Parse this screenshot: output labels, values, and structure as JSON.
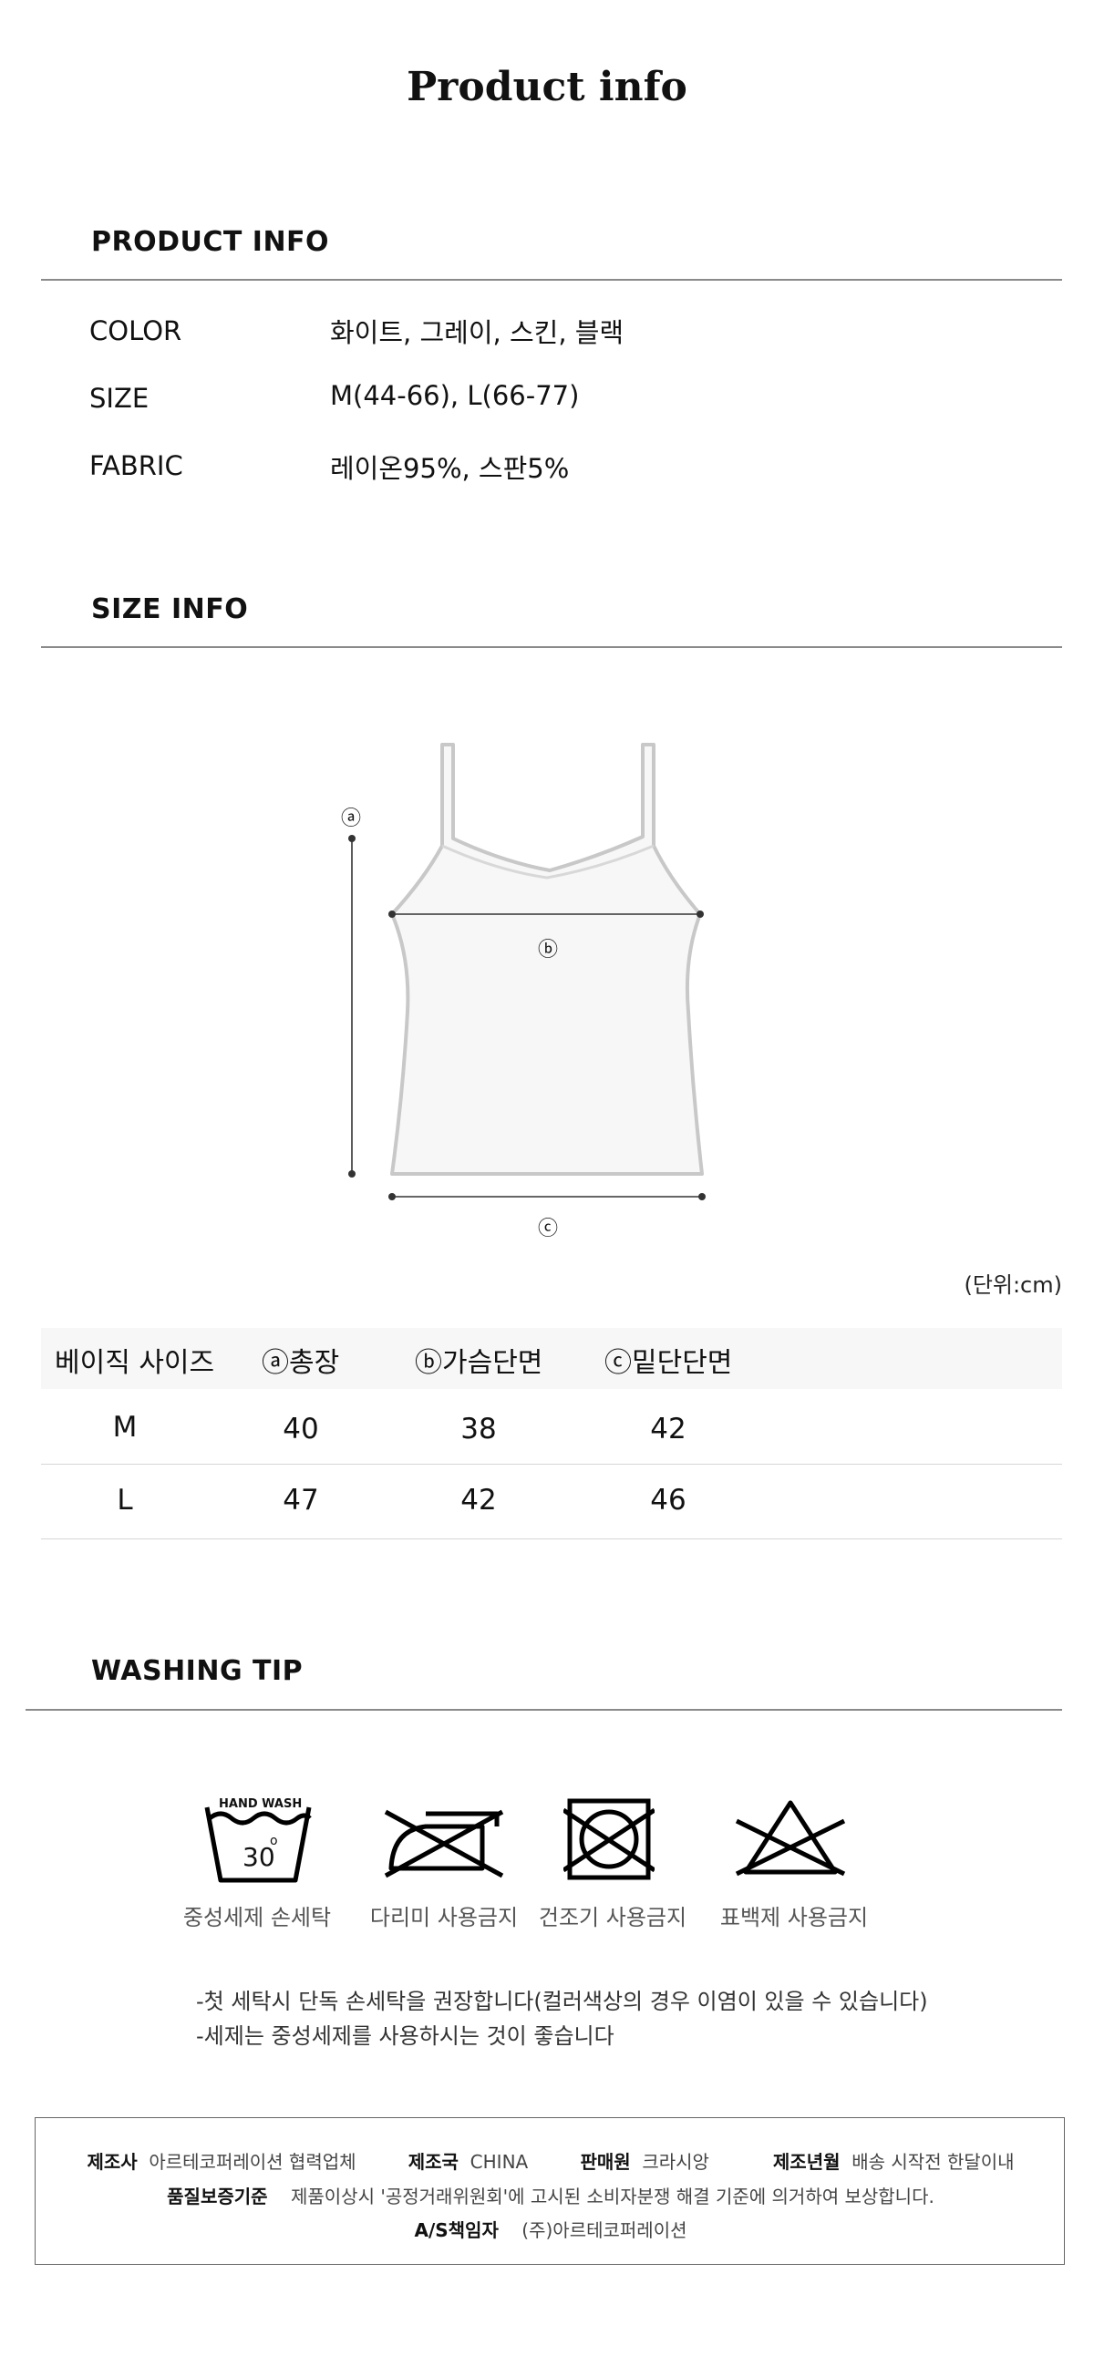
{
  "page_title": "Product info",
  "product_info": {
    "heading": "PRODUCT INFO",
    "rows": [
      {
        "label": "COLOR",
        "value": "화이트, 그레이, 스킨, 블랙"
      },
      {
        "label": "SIZE",
        "value": "M(44-66), L(66-77)"
      },
      {
        "label": "FABRIC",
        "value": "레이온95%, 스판5%"
      }
    ]
  },
  "size_info": {
    "heading": "SIZE INFO",
    "markers": {
      "a": "ⓐ",
      "b": "ⓑ",
      "c": "ⓒ"
    },
    "unit": "(단위:cm)",
    "table": {
      "headers": [
        "베이직 사이즈",
        "ⓐ총장",
        "ⓑ가슴단면",
        "ⓒ밑단단면"
      ],
      "rows": [
        [
          "M",
          "40",
          "38",
          "42"
        ],
        [
          "L",
          "47",
          "42",
          "46"
        ]
      ]
    }
  },
  "washing_tip": {
    "heading": "WASHING TIP",
    "icons": [
      {
        "icon": "hand-wash-icon",
        "caption": "중성세제 손세탁",
        "tub_label": "HAND WASH",
        "temp": "30"
      },
      {
        "icon": "no-iron-icon",
        "caption": "다리미 사용금지"
      },
      {
        "icon": "no-tumble-dry-icon",
        "caption": "건조기 사용금지"
      },
      {
        "icon": "no-bleach-icon",
        "caption": "표백제 사용금지"
      }
    ],
    "notes": [
      "-첫 세탁시 단독 손세탁을 권장합니다(컬러색상의 경우 이염이 있을 수 있습니다)",
      "-세제는 중성세제를 사용하시는 것이 좋습니다"
    ]
  },
  "footer": {
    "manufacturer_label": "제조사",
    "manufacturer": "아르테코퍼레이션 협력업체",
    "country_label": "제조국",
    "country": "CHINA",
    "seller_label": "판매원",
    "seller": "크라시앙",
    "date_label": "제조년월",
    "date": "배송 시작전 한달이내",
    "quality_label": "품질보증기준",
    "quality": "제품이상시 '공정거래위원회'에 고시된 소비자분쟁 해결 기준에 의거하여 보상합니다.",
    "as_label": "A/S책임자",
    "as": "(주)아르테코퍼레이션"
  }
}
